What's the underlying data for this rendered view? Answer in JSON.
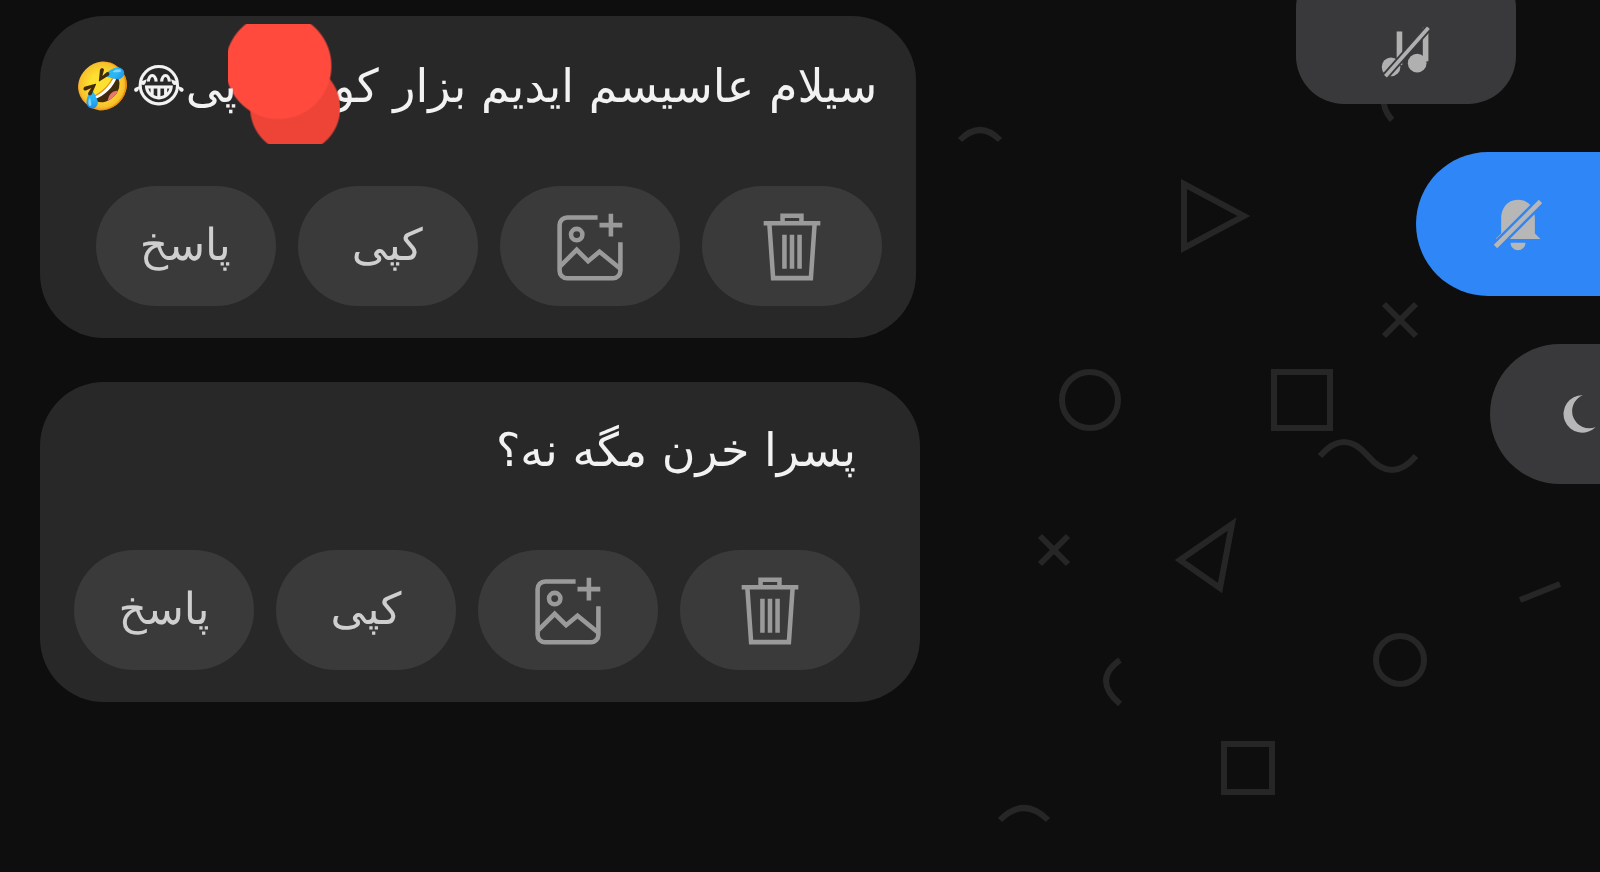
{
  "messages": [
    {
      "text": "سیلام عاسیسم ایدیم بزار کو",
      "redacted": true,
      "text_after": "پی😂🤣",
      "actions": [
        {
          "kind": "trash"
        },
        {
          "kind": "add-image"
        },
        {
          "kind": "text",
          "label": "کپی"
        },
        {
          "kind": "text",
          "label": "پاسخ"
        }
      ]
    },
    {
      "text": "پسرا خرن مگه نه؟",
      "redacted": false,
      "actions": [
        {
          "kind": "trash"
        },
        {
          "kind": "add-image"
        },
        {
          "kind": "text",
          "label": "کپی"
        },
        {
          "kind": "text",
          "label": "پاسخ"
        }
      ]
    }
  ],
  "side_buttons": [
    {
      "kind": "music-off",
      "on": false
    },
    {
      "kind": "bell-off",
      "on": true
    },
    {
      "kind": "moon",
      "on": false
    }
  ]
}
